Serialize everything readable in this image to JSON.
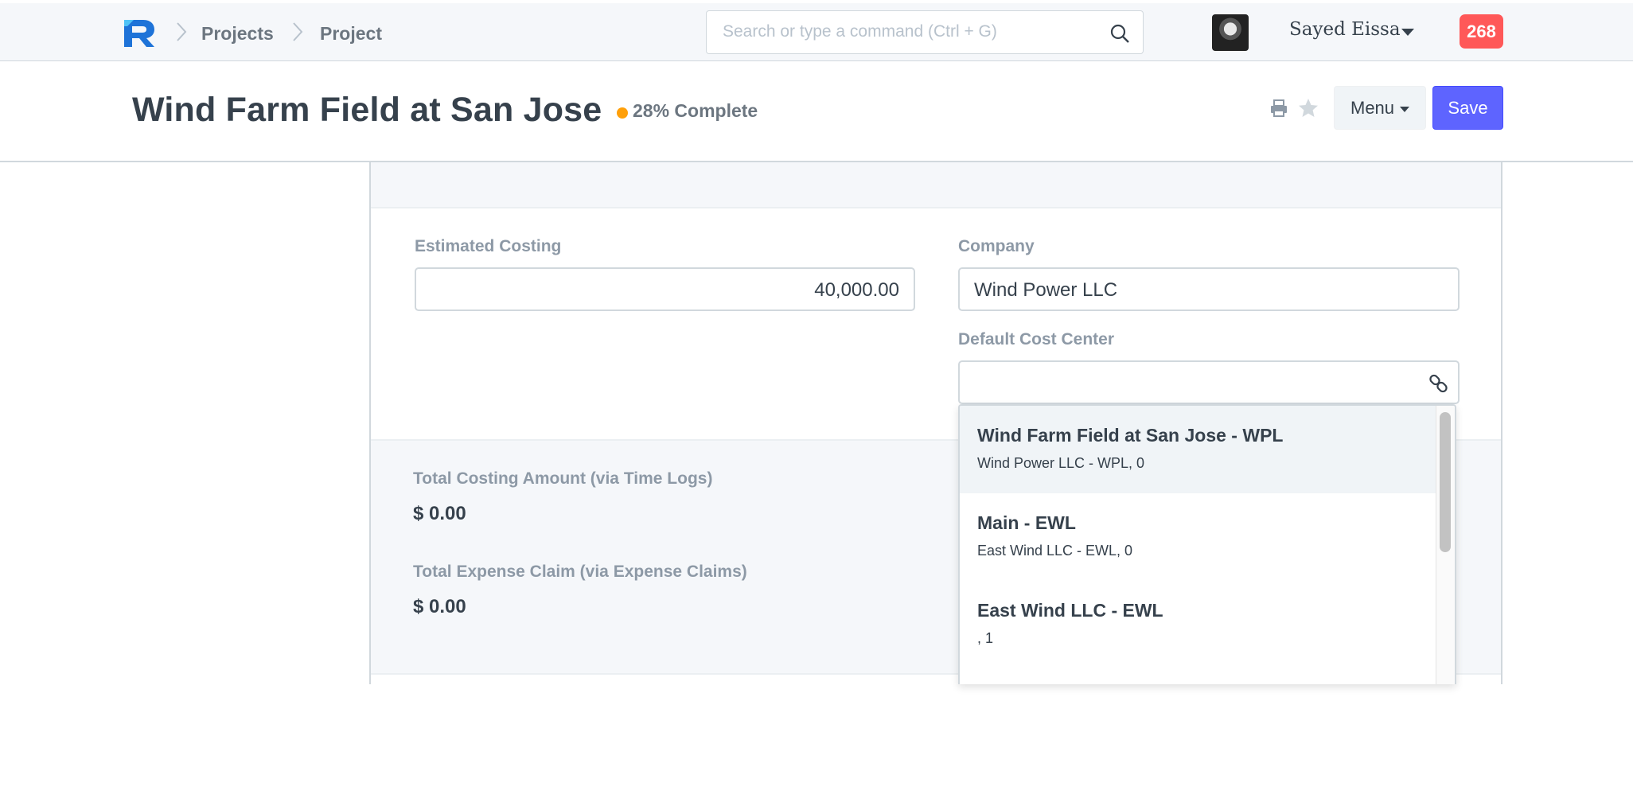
{
  "navbar": {
    "breadcrumbs": [
      "Projects",
      "Project"
    ],
    "search_placeholder": "Search or type a command (Ctrl + G)",
    "user_name": "Sayed Eissa",
    "notification_count": "268"
  },
  "page": {
    "title": "Wind Farm Field at San Jose",
    "indicator": "28% Complete",
    "indicator_color": "#ffa00a",
    "menu_label": "Menu",
    "save_label": "Save"
  },
  "form": {
    "estimated_costing": {
      "label": "Estimated Costing",
      "value": "40,000.00"
    },
    "company": {
      "label": "Company",
      "value": "Wind Power LLC"
    },
    "default_cost_center": {
      "label": "Default Cost Center",
      "value": ""
    },
    "total_costing": {
      "label": "Total Costing Amount (via Time Logs)",
      "value": "$ 0.00"
    },
    "total_expense": {
      "label": "Total Expense Claim (via Expense Claims)",
      "value": "$ 0.00"
    }
  },
  "dropdown": {
    "items": [
      {
        "title": "Wind Farm Field at San Jose - WPL",
        "subtitle": "Wind Power LLC - WPL, 0"
      },
      {
        "title": "Main - EWL",
        "subtitle": "East Wind LLC - EWL, 0"
      },
      {
        "title": "East Wind LLC - EWL",
        "subtitle": ", 1"
      }
    ]
  },
  "icons": {
    "logo": "r-logo-icon",
    "search": "search-icon",
    "print": "print-icon",
    "star": "star-icon",
    "link": "link-icon"
  },
  "colors": {
    "primary": "#5e64ff",
    "notification": "#ff5858"
  }
}
